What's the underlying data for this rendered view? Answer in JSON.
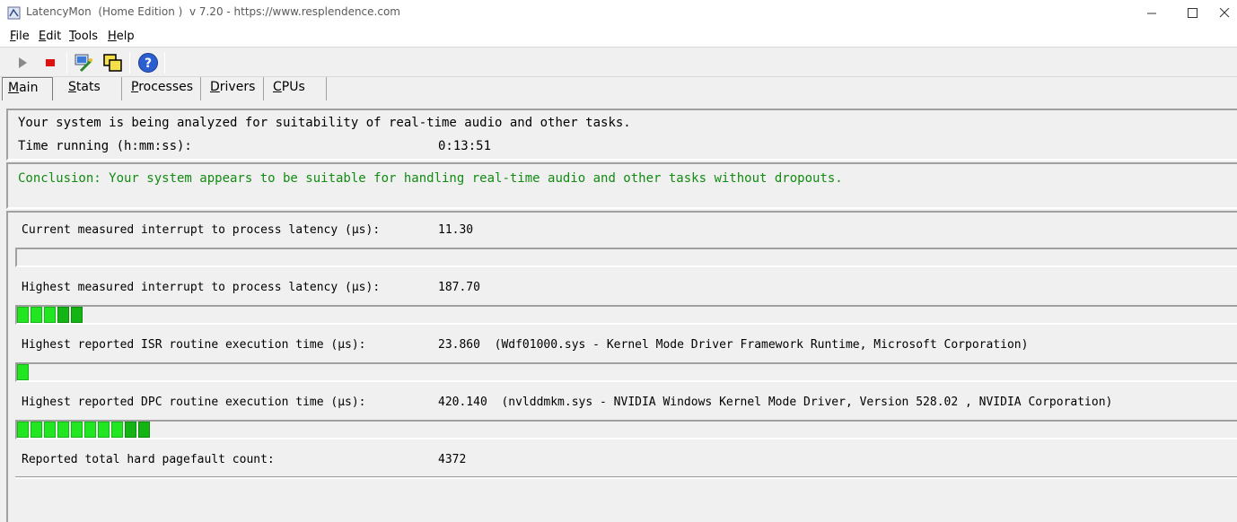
{
  "window": {
    "title": "LatencyMon  (Home Edition )  v 7.20 - https://www.resplendence.com",
    "minimize": "—",
    "maximize": "☐",
    "close": "✕"
  },
  "menu": {
    "items": [
      {
        "accel": "F",
        "rest": "ile"
      },
      {
        "accel": "E",
        "rest": "dit"
      },
      {
        "accel": "T",
        "rest": "ools"
      },
      {
        "accel": "H",
        "rest": "elp"
      }
    ]
  },
  "toolbar": {
    "icons": [
      "play-icon",
      "stop-icon",
      "wizard-icon",
      "windows-icon",
      "help-icon"
    ]
  },
  "tabs": [
    {
      "accel": "M",
      "rest": "ain",
      "active": true
    },
    {
      "accel": "S",
      "rest": "tats",
      "active": false
    },
    {
      "accel": "P",
      "rest": "rocesses",
      "active": false
    },
    {
      "accel": "D",
      "rest": "rivers",
      "active": false
    },
    {
      "accel": "C",
      "rest": "PUs",
      "active": false
    }
  ],
  "status": {
    "analyzing": "Your system is being analyzed for suitability of real-time audio and other tasks.",
    "time_label": "Time running (h:mm:ss):",
    "time_value": "0:13:51",
    "conclusion": "Conclusion: Your system appears to be suitable for handling real-time audio and other tasks without dropouts.",
    "conclusion_color": "#128b12"
  },
  "metrics": {
    "current": {
      "label": "Current measured interrupt to process latency (µs):",
      "value": "11.30",
      "level_segments": 0
    },
    "highest": {
      "label": "Highest measured interrupt to process latency (µs):",
      "value": "187.70",
      "level_segments": 5
    },
    "isr": {
      "label": "Highest reported ISR routine execution time (µs):",
      "value": "23.860  (Wdf01000.sys - Kernel Mode Driver Framework Runtime, Microsoft Corporation)",
      "level_segments": 1
    },
    "dpc": {
      "label": "Highest reported DPC routine execution time (µs):",
      "value": "420.140  (nvlddmkm.sys - NVIDIA Windows Kernel Mode Driver, Version 528.02 , NVIDIA Corporation)",
      "level_segments": 10
    },
    "pagefault": {
      "label": "Reported total hard pagefault count:",
      "value": "4372"
    }
  },
  "colors": {
    "bar_green": "#22e622",
    "bar_dark_green": "#14b414"
  }
}
